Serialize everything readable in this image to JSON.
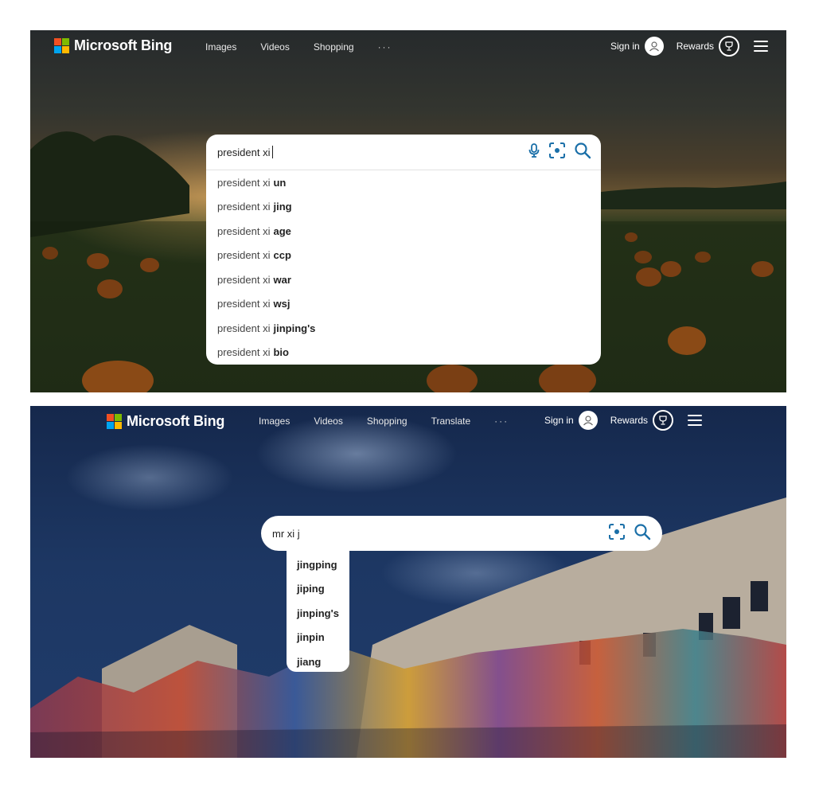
{
  "colors": {
    "logo_red": "#f25022",
    "logo_green": "#7fba00",
    "logo_blue": "#00a4ef",
    "logo_yellow": "#ffb900",
    "accent_blue": "#1a6fa8"
  },
  "screen1": {
    "header": {
      "brand": "Microsoft Bing",
      "nav": [
        "Images",
        "Videos",
        "Shopping"
      ],
      "more": "···",
      "sign_in": "Sign in",
      "rewards": "Rewards"
    },
    "search": {
      "query": "president xi",
      "icons": [
        "microphone-icon",
        "visual-search-icon",
        "search-icon"
      ],
      "suggestions": [
        {
          "prefix": "president xi",
          "completion": "un"
        },
        {
          "prefix": "president xi",
          "completion": "jing"
        },
        {
          "prefix": "president xi",
          "completion": "age"
        },
        {
          "prefix": "president xi",
          "completion": "ccp"
        },
        {
          "prefix": "president xi",
          "completion": "war"
        },
        {
          "prefix": "president xi",
          "completion": "wsj"
        },
        {
          "prefix": "president xi",
          "completion": "jinping's"
        },
        {
          "prefix": "president xi",
          "completion": "bio"
        }
      ]
    }
  },
  "screen2": {
    "header": {
      "brand": "Microsoft Bing",
      "nav": [
        "Images",
        "Videos",
        "Shopping",
        "Translate"
      ],
      "more": "···",
      "sign_in": "Sign in",
      "rewards": "Rewards"
    },
    "search": {
      "query": "mr xi j",
      "icons": [
        "visual-search-icon",
        "search-icon"
      ],
      "suggestions": [
        "jingping",
        "jiping",
        "jinping's",
        "jinpin",
        "jiang"
      ]
    }
  }
}
